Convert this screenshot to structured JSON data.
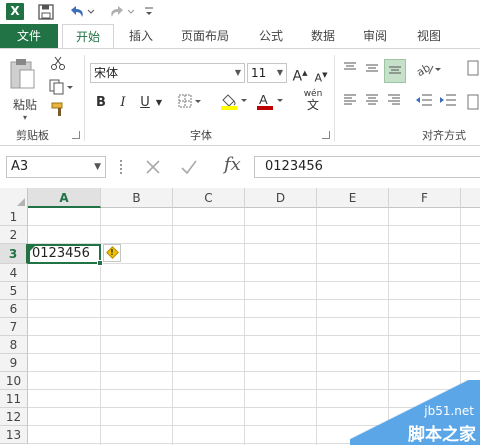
{
  "app": {
    "logo_text": "X"
  },
  "qat": {
    "save_icon": "save-icon",
    "undo_icon": "undo-icon",
    "redo_icon": "redo-icon",
    "more_icon": "customize-icon"
  },
  "tabs": [
    {
      "label": "文件"
    },
    {
      "label": "开始"
    },
    {
      "label": "插入"
    },
    {
      "label": "页面布局"
    },
    {
      "label": "公式"
    },
    {
      "label": "数据"
    },
    {
      "label": "审阅"
    },
    {
      "label": "视图"
    }
  ],
  "ribbon": {
    "clipboard": {
      "label": "剪贴板",
      "paste_label": "粘贴"
    },
    "font": {
      "label": "字体",
      "font_name": "宋体",
      "font_size": "11",
      "bold": "B",
      "italic": "I",
      "underline": "U",
      "grow": "A",
      "shrink": "A",
      "color_a": "A",
      "wen": "wén",
      "wen_char": "文"
    },
    "alignment": {
      "label": "对齐方式"
    }
  },
  "formula_bar": {
    "name_box": "A3",
    "formula_value": "0123456",
    "fx": "fx"
  },
  "grid": {
    "columns": [
      "A",
      "B",
      "C",
      "D",
      "E",
      "F"
    ],
    "rows": [
      "1",
      "2",
      "3",
      "4",
      "5",
      "6",
      "7",
      "8",
      "9",
      "10",
      "11",
      "12",
      "13"
    ],
    "selected_cell": "A3",
    "cell_a3_value": "0123456"
  },
  "watermark": {
    "url": "jb51.net",
    "text": "脚本之家"
  },
  "colors": {
    "accent": "#217346",
    "file_tab": "#217346",
    "highlight_yellow": "#ffff00",
    "font_red": "#c00000"
  }
}
